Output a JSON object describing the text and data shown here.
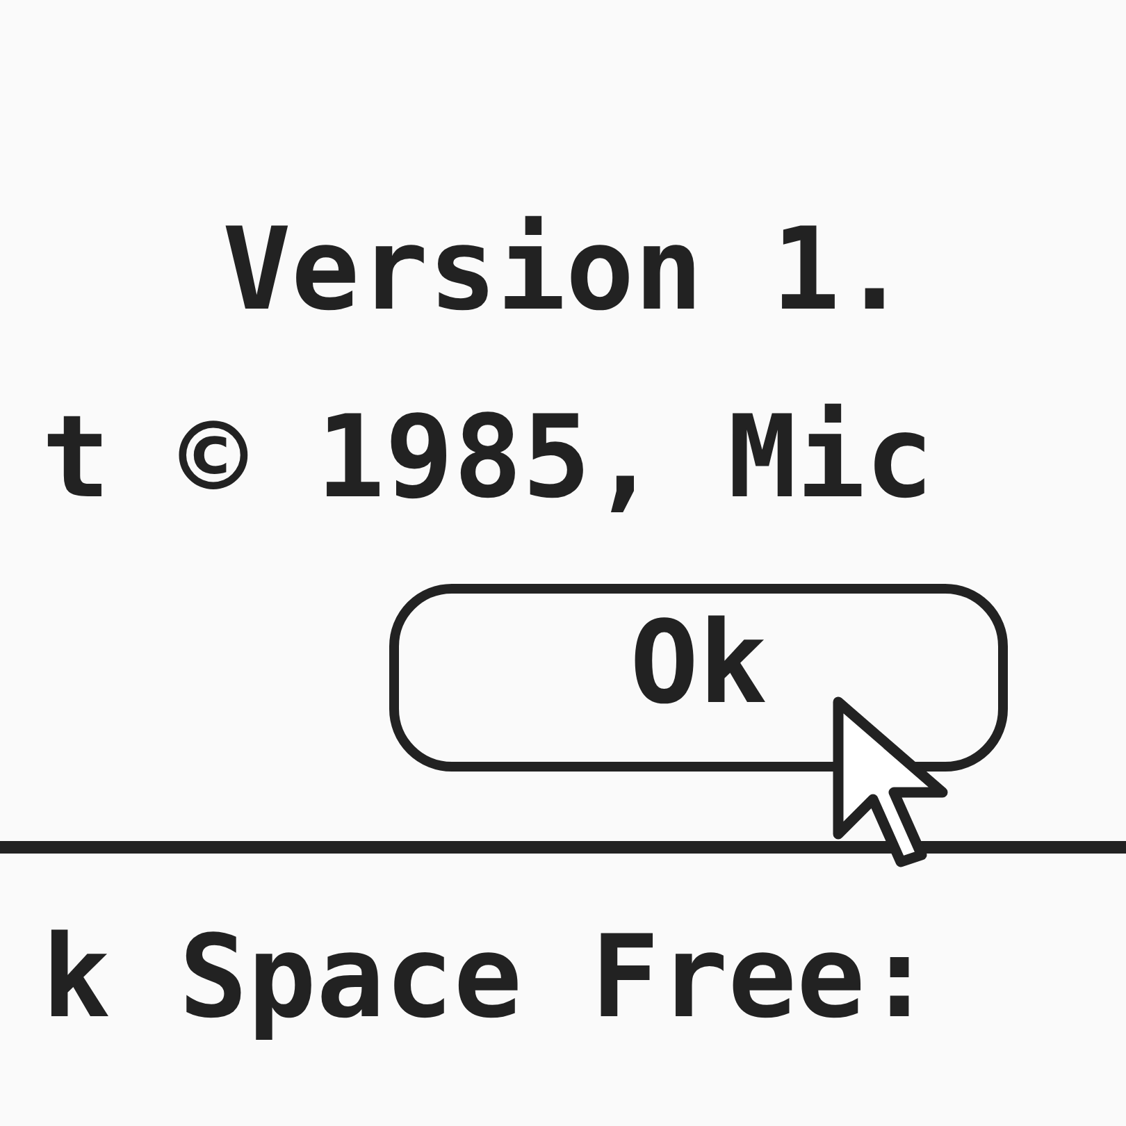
{
  "dialog": {
    "version": "Version 1.",
    "copyright": "t © 1985, Mic",
    "button": "Ok"
  },
  "status": {
    "disk_space": "k Space Free:"
  }
}
